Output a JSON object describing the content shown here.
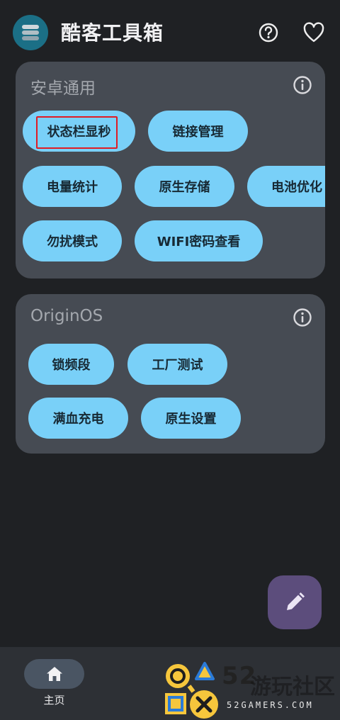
{
  "app": {
    "title": "酷客工具箱",
    "logo_icon": "stacked-layers-icon",
    "help_icon": "help-circle-icon",
    "favorite_icon": "heart-outline-icon"
  },
  "sections": [
    {
      "title": "安卓通用",
      "info_icon": "info-circle-icon",
      "buttons": [
        "状态栏显秒",
        "链接管理",
        "电量统计",
        "原生存储",
        "电池优化",
        "勿扰模式",
        "WIFI密码查看"
      ]
    },
    {
      "title": "OriginOS",
      "info_icon": "info-circle-icon",
      "buttons": [
        "锁频段",
        "工厂测试",
        "满血充电",
        "原生设置"
      ]
    }
  ],
  "fab": {
    "icon": "pencil-icon"
  },
  "bottom_nav": {
    "home_label": "主页",
    "home_icon": "home-icon"
  },
  "watermark": {
    "number": "52",
    "chinese": "游玩社区",
    "site": "52GAMERS.COM"
  },
  "colors": {
    "background": "#1f2124",
    "card": "#464b53",
    "chip": "#79d0f8",
    "chip_text": "#172934",
    "fab": "#5c4d7c",
    "highlight": "#e01b24"
  }
}
